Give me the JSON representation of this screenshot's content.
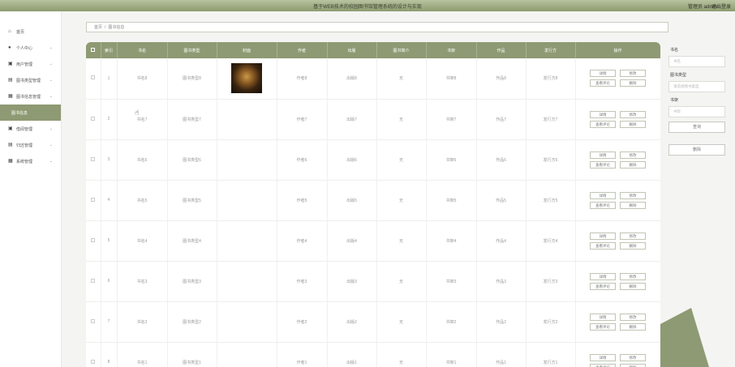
{
  "header": {
    "title": "基于WEB技术的校园图书馆管理系统的设计与实现",
    "user": "管理员 admin",
    "logout": "退出登录"
  },
  "sidebar": {
    "items": [
      {
        "label": "首页",
        "icon": "home-icon",
        "glyph": "⌂",
        "chevron": false
      },
      {
        "label": "个人中心",
        "icon": "user-icon",
        "glyph": "●",
        "chevron": true
      },
      {
        "label": "用户管理",
        "icon": "user-card-icon",
        "glyph": "▣",
        "chevron": true
      },
      {
        "label": "图书类型管理",
        "icon": "list-icon",
        "glyph": "▤",
        "chevron": true
      },
      {
        "label": "图书信息管理",
        "icon": "grid-icon",
        "glyph": "▦",
        "chevron": true
      },
      {
        "label": "图书信息",
        "icon": "",
        "glyph": "",
        "chevron": false,
        "active": true
      },
      {
        "label": "借阅管理",
        "icon": "book-icon",
        "glyph": "▣",
        "chevron": true
      },
      {
        "label": "归还管理",
        "icon": "return-icon",
        "glyph": "▤",
        "chevron": true
      },
      {
        "label": "系统管理",
        "icon": "grid-icon",
        "glyph": "▦",
        "chevron": true
      }
    ]
  },
  "breadcrumb": {
    "home": "首页",
    "current": "图书信息"
  },
  "table": {
    "columns": [
      "",
      "索引",
      "书名",
      "图书类型",
      "封面",
      "作者",
      "出版",
      "图书简介",
      "书架",
      "作品",
      "发行方",
      "操作"
    ],
    "rows": [
      {
        "index": "1",
        "name": "书名8",
        "type": "图书类型8",
        "has_cover": true,
        "author": "作者8",
        "press": "出版8",
        "intro": "无",
        "shelf": "书架8",
        "work": "作品8",
        "issuer": "发行方8"
      },
      {
        "index": "2",
        "name": "书名7",
        "type": "图书类型7",
        "has_cover": false,
        "author": "作者7",
        "press": "出版7",
        "intro": "无",
        "shelf": "书架7",
        "work": "作品7",
        "issuer": "发行方7"
      },
      {
        "index": "3",
        "name": "书名6",
        "type": "图书类型6",
        "has_cover": false,
        "author": "作者6",
        "press": "出版6",
        "intro": "无",
        "shelf": "书架6",
        "work": "作品6",
        "issuer": "发行方6"
      },
      {
        "index": "4",
        "name": "书名5",
        "type": "图书类型5",
        "has_cover": false,
        "author": "作者5",
        "press": "出版5",
        "intro": "无",
        "shelf": "书架5",
        "work": "作品5",
        "issuer": "发行方5"
      },
      {
        "index": "5",
        "name": "书名4",
        "type": "图书类型4",
        "has_cover": false,
        "author": "作者4",
        "press": "出版4",
        "intro": "无",
        "shelf": "书架4",
        "work": "作品4",
        "issuer": "发行方4"
      },
      {
        "index": "6",
        "name": "书名3",
        "type": "图书类型3",
        "has_cover": false,
        "author": "作者3",
        "press": "出版3",
        "intro": "无",
        "shelf": "书架3",
        "work": "作品3",
        "issuer": "发行方3"
      },
      {
        "index": "7",
        "name": "书名2",
        "type": "图书类型2",
        "has_cover": false,
        "author": "作者2",
        "press": "出版2",
        "intro": "无",
        "shelf": "书架2",
        "work": "作品2",
        "issuer": "发行方2"
      },
      {
        "index": "8",
        "name": "书名1",
        "type": "图书类型1",
        "has_cover": false,
        "author": "作者1",
        "press": "出版1",
        "intro": "无",
        "shelf": "书架1",
        "work": "作品1",
        "issuer": "发行方1"
      }
    ],
    "actions": {
      "detail": "详情",
      "edit": "修改",
      "review": "查看评论",
      "delete": "删除"
    }
  },
  "filter": {
    "name_label": "书名",
    "name_placeholder": "书名",
    "type_label": "图书类型",
    "type_placeholder": "请选择图书类型",
    "shelf_label": "书架",
    "shelf_placeholder": "书架",
    "search_label": "查询",
    "delete_label": "删除"
  },
  "colors": {
    "accent": "#8e9a73",
    "header": "#b7c2a0"
  }
}
